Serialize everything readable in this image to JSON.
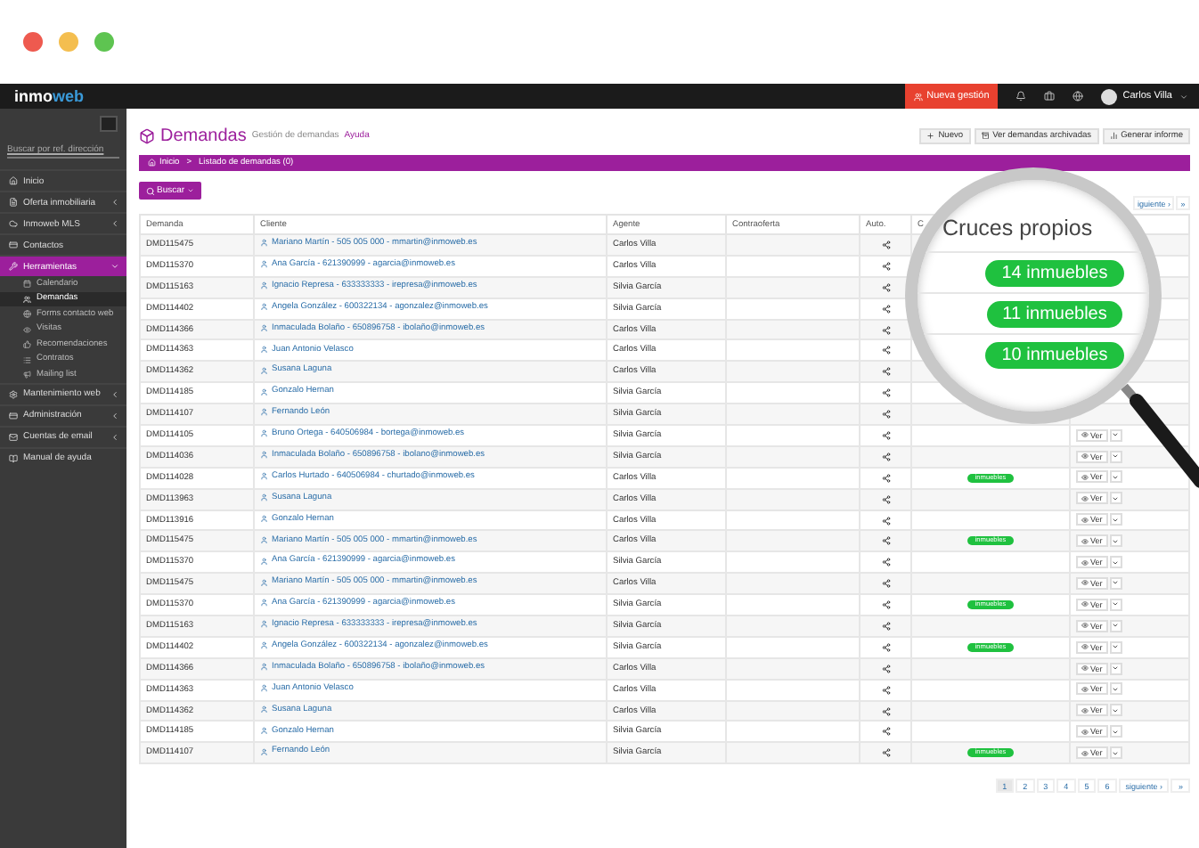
{
  "topbar": {
    "logo": {
      "part_1": "inmo",
      "part_2": "web"
    },
    "new_button": "Nueva gestión",
    "user": "Carlos Villa"
  },
  "sidebar": {
    "search": {
      "placeholder": "Buscar por ref. dirección"
    },
    "items": [
      {
        "label": "Inicio",
        "selected": false
      },
      {
        "label": "Oferta inmobiliaria",
        "selected": false,
        "expanded": false
      },
      {
        "label": "Inmoweb MLS",
        "selected": false,
        "expanded": false
      },
      {
        "label": "Contactos",
        "selected": false
      },
      {
        "label": "Herramientas",
        "selected": true,
        "expanded": true,
        "children": [
          {
            "label": "Calendario",
            "selected": false
          },
          {
            "label": "Demandas",
            "selected": true
          },
          {
            "label": "Forms contacto web",
            "selected": false
          },
          {
            "label": "Visitas",
            "selected": false
          },
          {
            "label": "Recomendaciones",
            "selected": false
          },
          {
            "label": "Contratos",
            "selected": false
          },
          {
            "label": "Mailing list",
            "selected": false
          }
        ]
      },
      {
        "label": "Mantenimiento web",
        "selected": false,
        "expanded": false
      },
      {
        "label": "Administración",
        "selected": false,
        "expanded": false
      },
      {
        "label": "Cuentas de email",
        "selected": false,
        "expanded": false
      },
      {
        "label": "Manual de ayuda",
        "selected": false
      }
    ]
  },
  "header": {
    "title": "Demandas",
    "subtitle": "Gestión de demandas",
    "help": "Ayuda",
    "buttons": [
      "Nuevo",
      "Ver demandas archivadas",
      "Generar informe"
    ]
  },
  "breadcrumb": {
    "items": [
      "Inicio",
      "Listado de demandas (0)"
    ],
    "separator": ">"
  },
  "search_button": "Buscar",
  "top_pagination": {
    "next": "iguiente ›",
    "last": "»"
  },
  "table": {
    "columns": [
      "Demanda",
      "Cliente",
      "Agente",
      "Contraoferta",
      "Auto.",
      "C"
    ],
    "rows": [
      {
        "id": "DMD115475",
        "client": "Mariano Martín - 505 005 000 - mmartin@inmoweb.es",
        "agent": "Carlos Villa"
      },
      {
        "id": "DMD115370",
        "client": "Ana García - 621390999 - agarcia@inmoweb.es",
        "agent": "Carlos Villa"
      },
      {
        "id": "DMD115163",
        "client": "Ignacio Represa - 633333333 - irepresa@inmoweb.es",
        "agent": "Silvia García"
      },
      {
        "id": "DMD114402",
        "client": "Angela González - 600322134 - agonzalez@inmoweb.es",
        "agent": "Silvia García"
      },
      {
        "id": "DMD114366",
        "client": "Inmaculada Bolaño - 650896758 - ibolaño@inmoweb.es",
        "agent": "Carlos Villa"
      },
      {
        "id": "DMD114363",
        "client": "Juan Antonio Velasco",
        "agent": "Carlos Villa"
      },
      {
        "id": "DMD114362",
        "client": "Susana Laguna",
        "agent": "Carlos Villa"
      },
      {
        "id": "DMD114185",
        "client": "Gonzalo Hernan",
        "agent": "Silvia García"
      },
      {
        "id": "DMD114107",
        "client": "Fernando León",
        "agent": "Silvia García"
      },
      {
        "id": "DMD114105",
        "client": "Bruno Ortega - 640506984 - bortega@inmoweb.es",
        "agent": "Silvia García",
        "action": "Ver"
      },
      {
        "id": "DMD114036",
        "client": "Inmaculada Bolaño - 650896758 - ibolano@inmoweb.es",
        "agent": "Silvia García",
        "action": "Ver"
      },
      {
        "id": "DMD114028",
        "client": "Carlos Hurtado - 640506984 - churtado@inmoweb.es",
        "agent": "Carlos Villa",
        "cruces": "inmuebles",
        "action": "Ver"
      },
      {
        "id": "DMD113963",
        "client": "Susana Laguna",
        "agent": "Carlos Villa",
        "action": "Ver"
      },
      {
        "id": "DMD113916",
        "client": "Gonzalo Hernan",
        "agent": "Carlos Villa",
        "action": "Ver"
      },
      {
        "id": "DMD115475",
        "client": "Mariano Martín - 505 005 000 - mmartin@inmoweb.es",
        "agent": "Carlos Villa",
        "cruces": "inmuebles",
        "action": "Ver"
      },
      {
        "id": "DMD115370",
        "client": "Ana García - 621390999 - agarcia@inmoweb.es",
        "agent": "Silvia García",
        "action": "Ver"
      },
      {
        "id": "DMD115475",
        "client": "Mariano Martín - 505 005 000 - mmartin@inmoweb.es",
        "agent": "Carlos Villa",
        "action": "Ver"
      },
      {
        "id": "DMD115370",
        "client": "Ana García - 621390999 - agarcia@inmoweb.es",
        "agent": "Silvia García",
        "cruces": "inmuebles",
        "action": "Ver"
      },
      {
        "id": "DMD115163",
        "client": "Ignacio Represa - 633333333 - irepresa@inmoweb.es",
        "agent": "Silvia García",
        "action": "Ver"
      },
      {
        "id": "DMD114402",
        "client": "Angela González - 600322134 - agonzalez@inmoweb.es",
        "agent": "Silvia García",
        "cruces": "inmuebles",
        "action": "Ver"
      },
      {
        "id": "DMD114366",
        "client": "Inmaculada Bolaño - 650896758 - ibolaño@inmoweb.es",
        "agent": "Carlos Villa",
        "action": "Ver"
      },
      {
        "id": "DMD114363",
        "client": "Juan Antonio Velasco",
        "agent": "Carlos Villa",
        "action": "Ver"
      },
      {
        "id": "DMD114362",
        "client": "Susana Laguna",
        "agent": "Carlos Villa",
        "action": "Ver"
      },
      {
        "id": "DMD114185",
        "client": "Gonzalo Hernan",
        "agent": "Silvia García",
        "action": "Ver"
      },
      {
        "id": "DMD114107",
        "client": "Fernando León",
        "agent": "Silvia García",
        "cruces": "inmuebles",
        "action": "Ver"
      }
    ]
  },
  "pagination": {
    "pages": [
      {
        "label": "1",
        "selected": true
      },
      {
        "label": "2",
        "selected": false
      },
      {
        "label": "3",
        "selected": false
      },
      {
        "label": "4",
        "selected": false
      },
      {
        "label": "5",
        "selected": false
      },
      {
        "label": "6",
        "selected": false
      }
    ],
    "next": "siguiente ›",
    "last": "»"
  },
  "magnifier": {
    "title": "Cruces propios",
    "badges": [
      "14 inmuebles",
      "11 inmuebles",
      "10 inmuebles"
    ]
  }
}
